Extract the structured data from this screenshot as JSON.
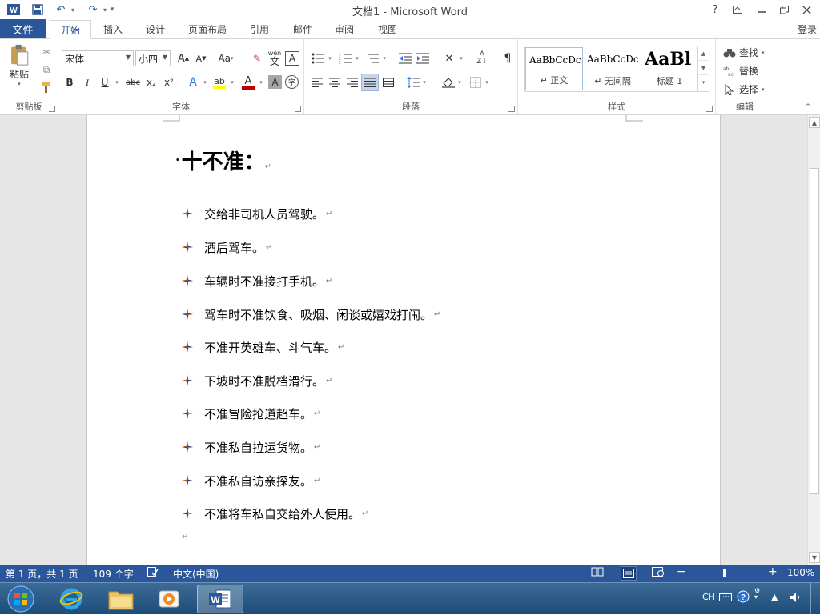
{
  "window": {
    "title": "文档1 - Microsoft Word",
    "help": "?",
    "ribbon_display": "⊡",
    "minimize": "—",
    "restore": "❐",
    "close": "✕"
  },
  "quick_access": {
    "app_icon": "W",
    "save": "💾",
    "undo": "↶",
    "redo": "↷",
    "customize": "▾"
  },
  "tabs": {
    "file": "文件",
    "items": [
      "开始",
      "插入",
      "设计",
      "页面布局",
      "引用",
      "邮件",
      "审阅",
      "视图"
    ],
    "active_index": 0,
    "login": "登录"
  },
  "ribbon": {
    "clipboard": {
      "label": "剪贴板",
      "paste": "粘贴",
      "cut": "✂",
      "copy": "⧉",
      "format_painter": "🖌"
    },
    "font": {
      "label": "字体",
      "font_name": "宋体",
      "font_size": "小四",
      "grow": "A",
      "shrink": "A",
      "change_case": "Aa",
      "clear_format": "✎",
      "phonetic": "wén",
      "phonetic_char": "文",
      "char_border": "A",
      "bold": "B",
      "italic": "I",
      "underline": "U",
      "strikethrough": "abc",
      "subscript": "x₂",
      "superscript": "x²",
      "text_effect": "A",
      "highlight": "ab",
      "font_color": "A",
      "char_shading": "A",
      "enclose": "字"
    },
    "paragraph": {
      "label": "段落",
      "show_marks": "¶",
      "sort": "A↓Z"
    },
    "styles": {
      "label": "样式",
      "items": [
        {
          "sample": "AaBbCcDc",
          "name": "↵ 正文"
        },
        {
          "sample": "AaBbCcDc",
          "name": "↵ 无间隔"
        },
        {
          "sample": "AaBl",
          "name": "标题 1"
        }
      ]
    },
    "editing": {
      "label": "编辑",
      "find": "查找",
      "replace": "替换",
      "select": "选择"
    }
  },
  "document": {
    "heading": "十不准：",
    "items": [
      "交给非司机人员驾驶。",
      "酒后驾车。",
      "车辆时不准接打手机。",
      "驾车时不准饮食、吸烟、闲谈或嬉戏打闹。",
      "不准开英雄车、斗气车。",
      "下坡时不准脱档滑行。",
      "不准冒险抢道超车。",
      "不准私自拉运货物。",
      "不准私自访亲探友。",
      "不准将车私自交给外人使用。"
    ],
    "para_mark": "↵"
  },
  "status": {
    "page": "第 1 页，共 1 页",
    "words": "109 个字",
    "language": "中文(中国)",
    "zoom": "100%",
    "zoom_minus": "−",
    "zoom_plus": "+"
  },
  "taskbar": {
    "tray_lang": "CH",
    "apps": [
      "start-orb",
      "internet-explorer",
      "file-explorer",
      "media-player",
      "word"
    ]
  },
  "colors": {
    "accent": "#2b579a",
    "highlight": "#ffff00",
    "font_color": "#c00000"
  }
}
